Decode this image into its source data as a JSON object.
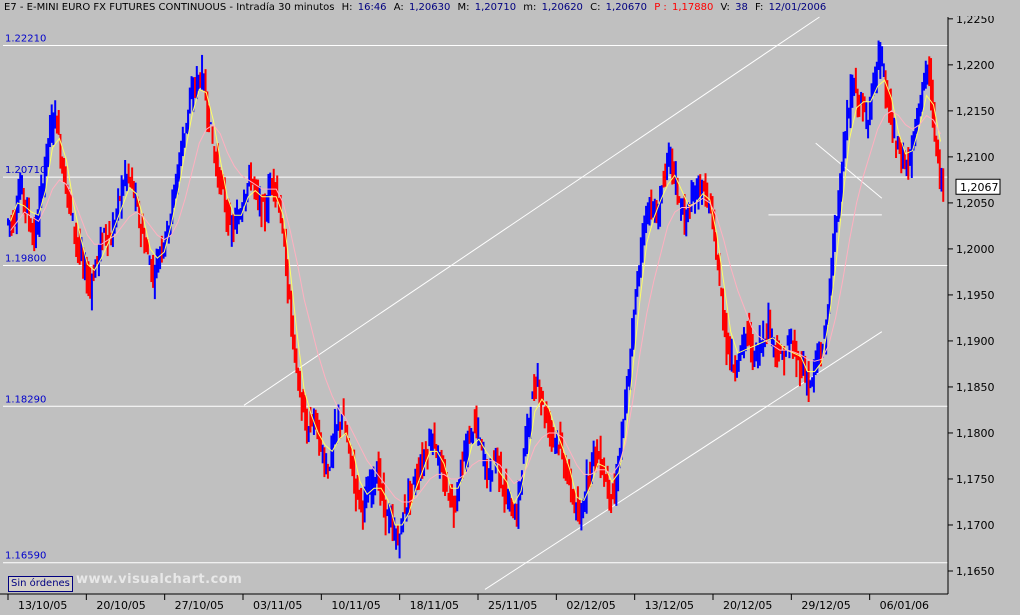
{
  "header": {
    "symbol": "E7",
    "name": "E-MINI EURO FX FUTURES CONTINUOUS",
    "interval": "Intradía 30 minutos",
    "h_label": "H:",
    "h_value": "16:46",
    "a_label": "A:",
    "a_value": "1,20630",
    "m_label": "M:",
    "m_value": "1,20710",
    "mm_label": "m:",
    "mm_value": "1,20620",
    "c_label": "C:",
    "c_value": "1,20670",
    "p_label": "P :",
    "p_value": "1,17880",
    "v_label": "V:",
    "v_value": "38",
    "f_label": "F:",
    "f_value": "12/01/2006"
  },
  "status": {
    "orders_button": "Sin órdenes",
    "watermark": "www.visualchart.com"
  },
  "colors": {
    "background": "#c0c0c0",
    "up_bar": "#0000ff",
    "down_bar": "#ff0000",
    "ma_fast": "#ffff66",
    "ma_slow": "#ffb0c0",
    "lines": "#ffffff",
    "label_text": "#0000cc"
  },
  "chart_data": {
    "type": "line",
    "title": "E-MINI EURO FX FUTURES CONTINUOUS",
    "xlabel": "",
    "ylabel": "",
    "ylim": [
      1.1625,
      1.2252
    ],
    "grid": false,
    "x_ticks": [
      "13/10/05",
      "20/10/05",
      "27/10/05",
      "03/11/05",
      "10/11/05",
      "18/11/05",
      "25/11/05",
      "02/12/05",
      "13/12/05",
      "20/12/05",
      "29/12/05",
      "06/01/06"
    ],
    "y_ticks": [
      "1,2250",
      "1,2200",
      "1,2150",
      "1,2100",
      "1,2050",
      "1,2000",
      "1,1950",
      "1,1900",
      "1,1850",
      "1,1800",
      "1,1750",
      "1,1700",
      "1,1650"
    ],
    "y_tick_values": [
      1.225,
      1.22,
      1.215,
      1.21,
      1.205,
      1.2,
      1.195,
      1.19,
      1.185,
      1.18,
      1.175,
      1.17,
      1.165
    ],
    "last_price": "1,2067",
    "last_price_value": 1.2067,
    "horizontal_levels": [
      {
        "label": "1.22210",
        "value": 1.2221
      },
      {
        "label": "1.20710",
        "value": 1.2078
      },
      {
        "label": "1.19800",
        "value": 1.1982
      },
      {
        "label": "1.18290",
        "value": 1.1829
      },
      {
        "label": "1.16590",
        "value": 1.1659
      }
    ],
    "trendlines": [
      {
        "x1": 0.255,
        "y1": 1.183,
        "x2": 0.864,
        "y2": 1.2252
      },
      {
        "x1": 0.51,
        "y1": 1.163,
        "x2": 0.93,
        "y2": 1.191
      },
      {
        "x1": 0.86,
        "y1": 1.2115,
        "x2": 0.93,
        "y2": 1.2055
      },
      {
        "x1": 0.81,
        "y1": 1.2037,
        "x2": 0.93,
        "y2": 1.2037
      }
    ],
    "series": [
      {
        "name": "",
        "values": [
          1.203,
          1.207,
          1.204,
          1.201,
          1.206,
          1.212,
          1.215,
          1.209,
          1.205,
          1.201,
          1.198,
          1.196,
          1.199,
          1.202,
          1.201,
          1.205,
          1.208,
          1.207,
          1.203,
          1.2,
          1.197,
          1.2,
          1.202,
          1.206,
          1.211,
          1.215,
          1.218,
          1.219,
          1.214,
          1.209,
          1.206,
          1.202,
          1.203,
          1.206,
          1.208,
          1.205,
          1.204,
          1.208,
          1.205,
          1.198,
          1.19,
          1.184,
          1.18,
          1.182,
          1.178,
          1.176,
          1.18,
          1.182,
          1.178,
          1.174,
          1.172,
          1.174,
          1.176,
          1.172,
          1.17,
          1.168,
          1.172,
          1.174,
          1.176,
          1.178,
          1.18,
          1.176,
          1.174,
          1.172,
          1.176,
          1.179,
          1.181,
          1.178,
          1.175,
          1.178,
          1.174,
          1.172,
          1.171,
          1.178,
          1.183,
          1.186,
          1.182,
          1.18,
          1.179,
          1.176,
          1.173,
          1.17,
          1.175,
          1.178,
          1.177,
          1.174,
          1.173,
          1.18,
          1.186,
          1.195,
          1.202,
          1.205,
          1.203,
          1.208,
          1.21,
          1.206,
          1.203,
          1.205,
          1.207,
          1.206,
          1.203,
          1.196,
          1.19,
          1.187,
          1.189,
          1.191,
          1.188,
          1.19,
          1.192,
          1.189,
          1.188,
          1.19,
          1.188,
          1.187,
          1.185,
          1.188,
          1.19,
          1.198,
          1.206,
          1.212,
          1.218,
          1.216,
          1.214,
          1.218,
          1.221,
          1.216,
          1.212,
          1.21,
          1.209,
          1.213,
          1.218,
          1.219,
          1.21,
          1.206
        ]
      },
      {
        "name": "",
        "values": [
          1.202,
          1.203,
          1.204,
          1.2035,
          1.203,
          1.2045,
          1.2065,
          1.2075,
          1.207,
          1.2055,
          1.2035,
          1.2015,
          1.2005,
          1.2005,
          1.201,
          1.2015,
          1.2025,
          1.2035,
          1.204,
          1.2035,
          1.2025,
          1.2015,
          1.201,
          1.2015,
          1.203,
          1.2055,
          1.2085,
          1.2115,
          1.213,
          1.2135,
          1.2125,
          1.2105,
          1.209,
          1.208,
          1.2075,
          1.207,
          1.2065,
          1.2065,
          1.2065,
          1.205,
          1.202,
          1.1985,
          1.1945,
          1.1915,
          1.1885,
          1.186,
          1.184,
          1.1825,
          1.1815,
          1.18,
          1.1785,
          1.177,
          1.176,
          1.175,
          1.174,
          1.173,
          1.1725,
          1.1725,
          1.173,
          1.174,
          1.175,
          1.1755,
          1.1755,
          1.175,
          1.175,
          1.1755,
          1.1765,
          1.177,
          1.177,
          1.177,
          1.1765,
          1.1755,
          1.1745,
          1.175,
          1.1765,
          1.1785,
          1.1795,
          1.18,
          1.18,
          1.1795,
          1.178,
          1.1765,
          1.1755,
          1.1755,
          1.176,
          1.176,
          1.1755,
          1.1765,
          1.179,
          1.1835,
          1.1885,
          1.193,
          1.1965,
          1.1995,
          1.2025,
          1.204,
          1.2045,
          1.2045,
          1.205,
          1.2055,
          1.205,
          1.2035,
          1.201,
          1.198,
          1.1955,
          1.1935,
          1.1915,
          1.1905,
          1.19,
          1.1895,
          1.189,
          1.189,
          1.1888,
          1.1885,
          1.188,
          1.1878,
          1.188,
          1.1895,
          1.1925,
          1.1965,
          1.201,
          1.205,
          1.208,
          1.2105,
          1.213,
          1.2145,
          1.215,
          1.2145,
          1.2135,
          1.213,
          1.2135,
          1.2145,
          1.214,
          1.2125
        ]
      }
    ]
  }
}
